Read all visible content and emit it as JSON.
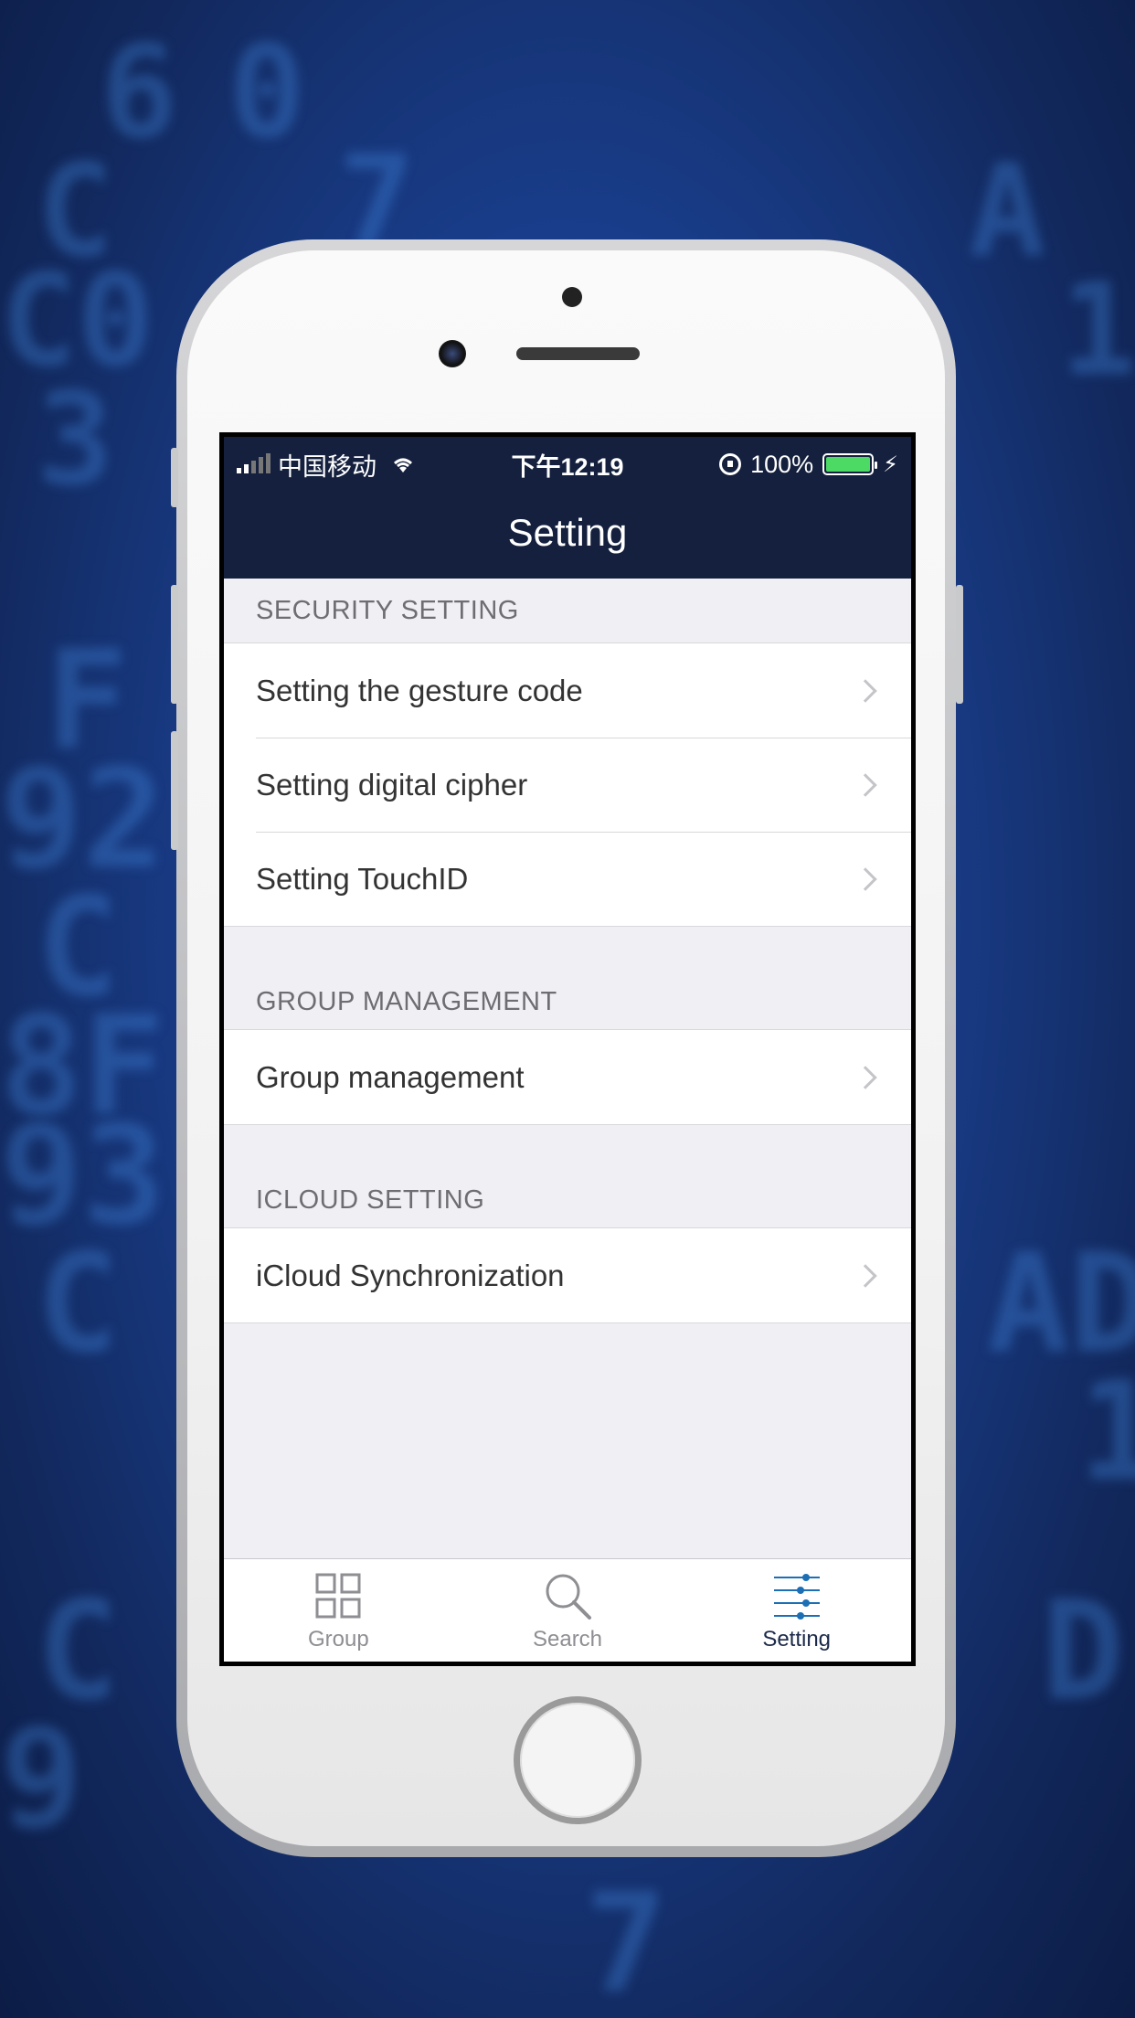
{
  "status_bar": {
    "carrier": "中国移动",
    "time": "下午12:19",
    "battery": "100%",
    "battery_level": 1.0
  },
  "nav": {
    "title": "Setting"
  },
  "sections": [
    {
      "header": "SECURITY SETTING",
      "items": [
        {
          "label": "Setting the gesture code"
        },
        {
          "label": "Setting digital cipher"
        },
        {
          "label": "Setting TouchID"
        }
      ]
    },
    {
      "header": "GROUP MANAGEMENT",
      "items": [
        {
          "label": "Group management"
        }
      ]
    },
    {
      "header": "ICLOUD SETTING",
      "items": [
        {
          "label": "iCloud Synchronization"
        }
      ]
    }
  ],
  "tabbar": {
    "tabs": [
      {
        "label": "Group",
        "icon": "grid-icon"
      },
      {
        "label": "Search",
        "icon": "search-icon"
      },
      {
        "label": "Setting",
        "icon": "sliders-icon",
        "active": true
      }
    ]
  },
  "colors": {
    "navbar_bg": "#14203d",
    "accent": "#1c6fb5",
    "battery_green": "#4cd964"
  }
}
